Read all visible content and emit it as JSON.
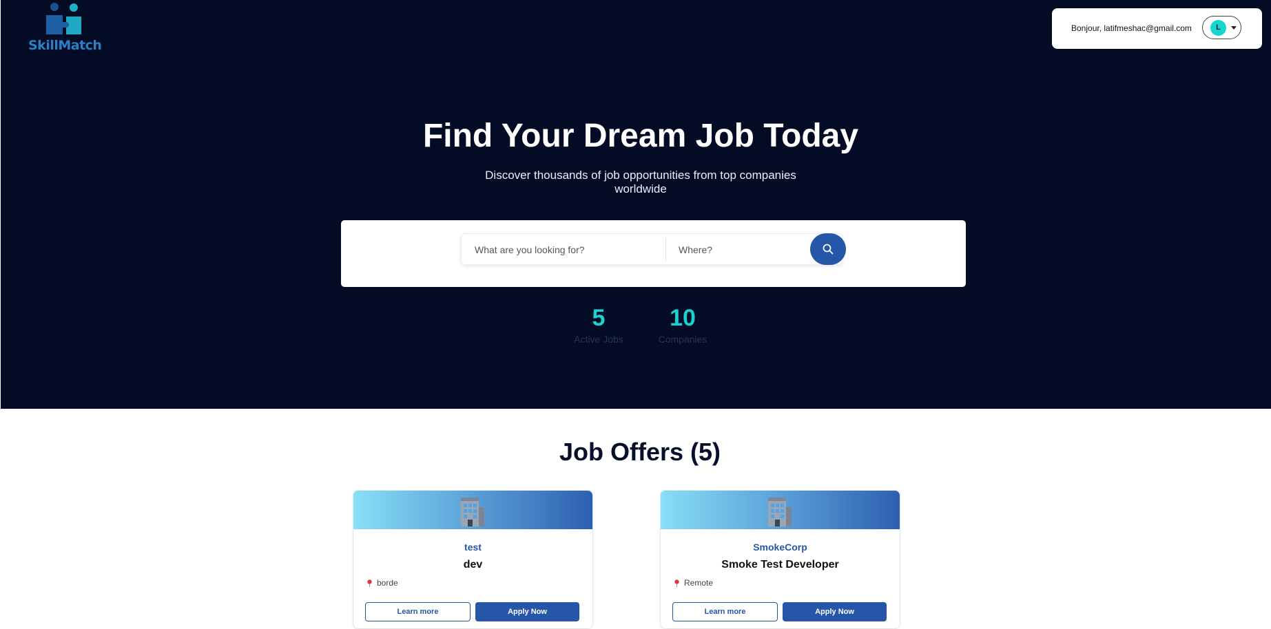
{
  "brand": {
    "name": "SkillMatch"
  },
  "user": {
    "greeting": "Bonjour, latifmeshac@gmail.com",
    "avatar_initial": "L"
  },
  "hero": {
    "title": "Find Your Dream Job Today",
    "subtitle": "Discover thousands of job opportunities from top companies worldwide"
  },
  "search": {
    "what_placeholder": "What are you looking for?",
    "where_placeholder": "Where?"
  },
  "stats": [
    {
      "value": "5",
      "label": "Active Jobs"
    },
    {
      "value": "10",
      "label": "Companies"
    }
  ],
  "offers": {
    "title": "Job Offers (5)",
    "cards": [
      {
        "company": "test",
        "title": "dev",
        "location": "borde",
        "learn_label": "Learn more",
        "apply_label": "Apply Now"
      },
      {
        "company": "SmokeCorp",
        "title": "Smoke Test Developer",
        "location": "Remote",
        "learn_label": "Learn more",
        "apply_label": "Apply Now"
      }
    ]
  },
  "colors": {
    "hero_bg": "#040b24",
    "accent": "#2656a8",
    "stat": "#19d2d2"
  },
  "icons": [
    "puzzle-people-logo-icon",
    "chevron-down-icon",
    "search-icon",
    "office-building-icon",
    "location-pin-icon"
  ]
}
